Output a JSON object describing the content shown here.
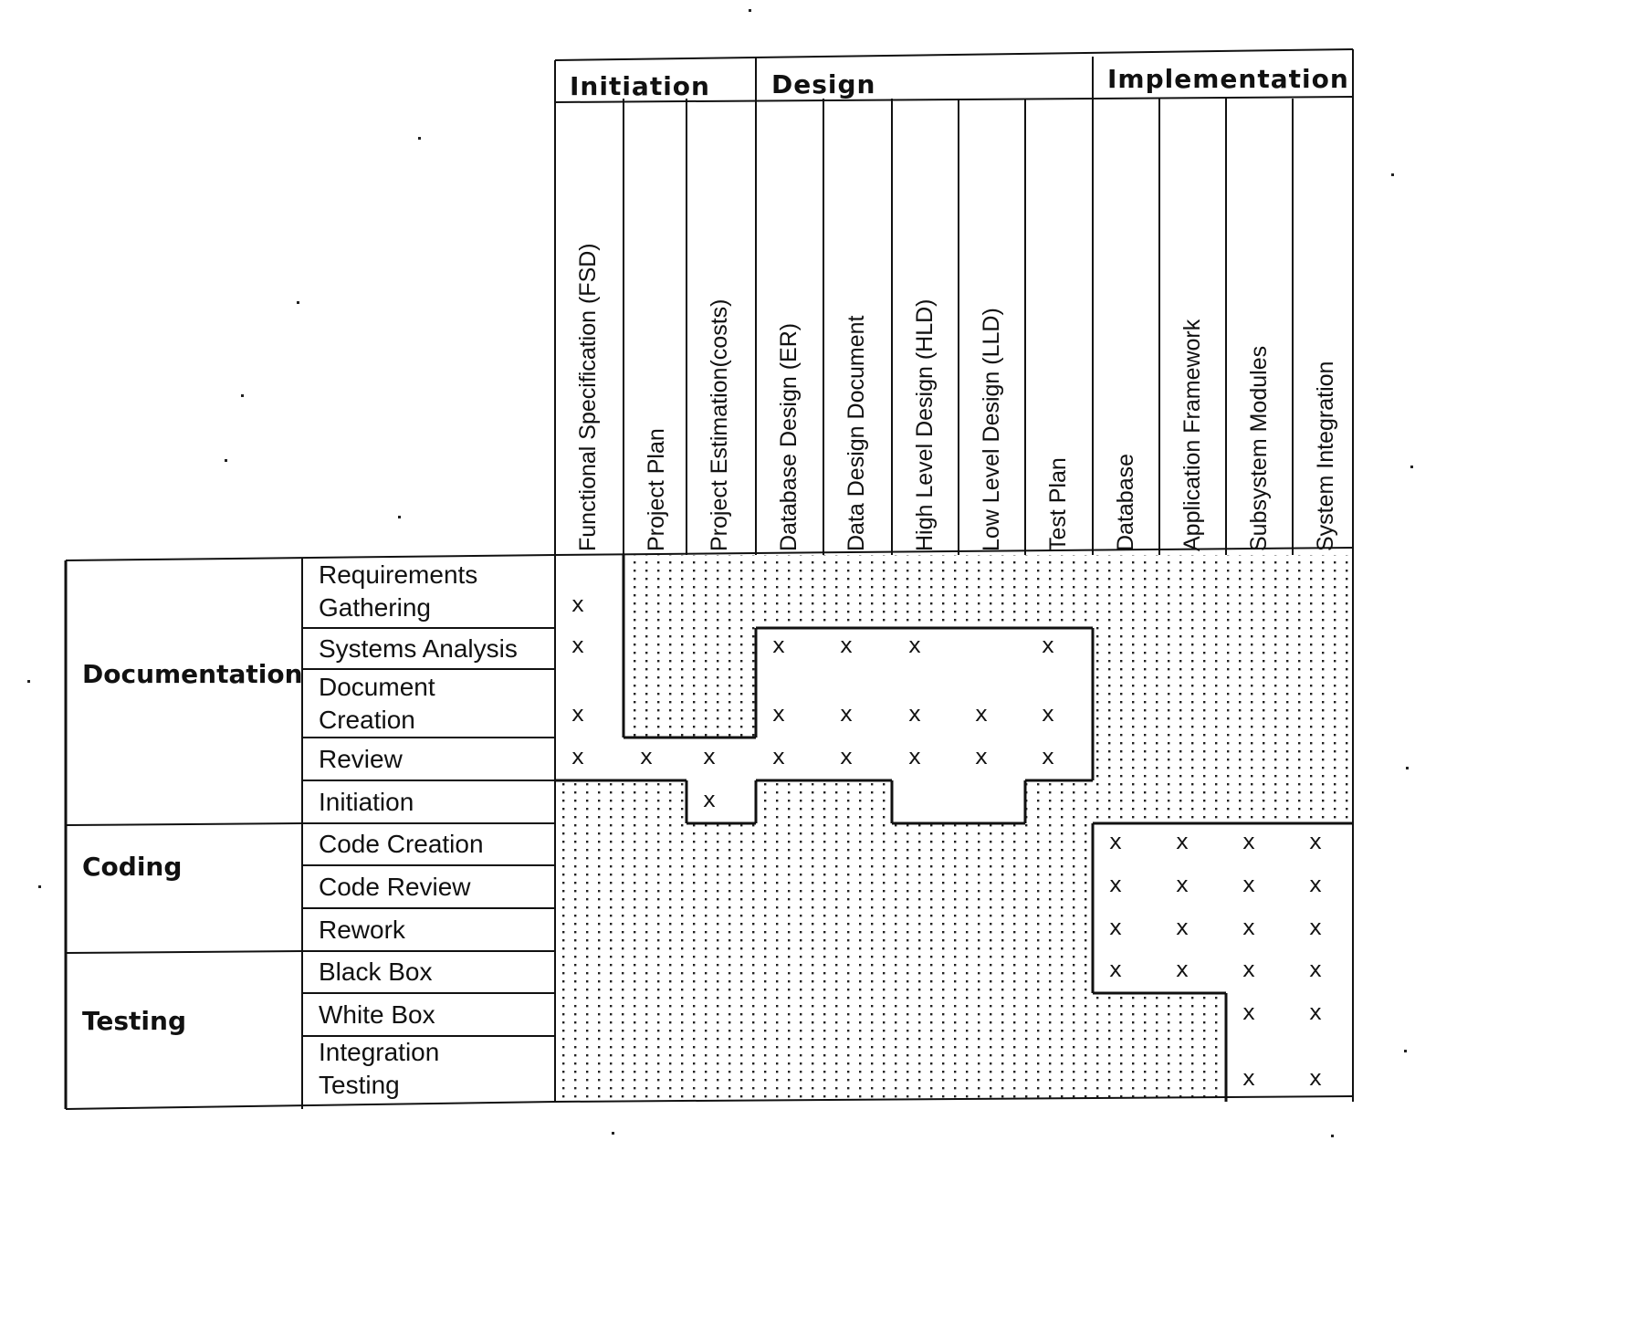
{
  "phases": [
    {
      "label": "Initiation"
    },
    {
      "label": "Design"
    },
    {
      "label": "Implementation"
    }
  ],
  "columns": [
    {
      "label": "Functional Specification (FSD)",
      "phase": "Initiation"
    },
    {
      "label": "Project Plan",
      "phase": "Initiation"
    },
    {
      "label": "Project Estimation(costs)",
      "phase": "Initiation"
    },
    {
      "label": "Database Design (ER)",
      "phase": "Design"
    },
    {
      "label": "Data Design Document",
      "phase": "Design"
    },
    {
      "label": "High Level Design (HLD)",
      "phase": "Design"
    },
    {
      "label": "Low Level Design (LLD)",
      "phase": "Design"
    },
    {
      "label": "Test Plan",
      "phase": "Design"
    },
    {
      "label": "Database",
      "phase": "Implementation"
    },
    {
      "label": "Application Framework",
      "phase": "Implementation"
    },
    {
      "label": "Subsystem Modules",
      "phase": "Implementation"
    },
    {
      "label": "System Integration",
      "phase": "Implementation"
    }
  ],
  "categories": [
    {
      "label": "Documentation"
    },
    {
      "label": "Coding"
    },
    {
      "label": "Testing"
    }
  ],
  "rows": [
    {
      "label_lines": [
        "Requirements",
        "Gathering"
      ],
      "category": "Documentation",
      "marks": [
        0
      ]
    },
    {
      "label_lines": [
        "Systems Analysis"
      ],
      "category": "Documentation",
      "marks": [
        0,
        3,
        4,
        5,
        7
      ]
    },
    {
      "label_lines": [
        "Document",
        "Creation"
      ],
      "category": "Documentation",
      "marks": [
        0,
        3,
        4,
        5,
        6,
        7
      ]
    },
    {
      "label_lines": [
        "Review"
      ],
      "category": "Documentation",
      "marks": [
        0,
        1,
        2,
        3,
        4,
        5,
        6,
        7
      ]
    },
    {
      "label_lines": [
        "Initiation"
      ],
      "category": "Documentation",
      "marks": [
        2
      ]
    },
    {
      "label_lines": [
        "Code Creation"
      ],
      "category": "Coding",
      "marks": [
        8,
        9,
        10,
        11
      ]
    },
    {
      "label_lines": [
        "Code Review"
      ],
      "category": "Coding",
      "marks": [
        8,
        9,
        10,
        11
      ]
    },
    {
      "label_lines": [
        "Rework"
      ],
      "category": "Coding",
      "marks": [
        8,
        9,
        10,
        11
      ]
    },
    {
      "label_lines": [
        "Black Box"
      ],
      "category": "Testing",
      "marks": [
        8,
        9,
        10,
        11
      ]
    },
    {
      "label_lines": [
        "White Box"
      ],
      "category": "Testing",
      "marks": [
        10,
        11
      ]
    },
    {
      "label_lines": [
        "Integration",
        "Testing"
      ],
      "category": "Testing",
      "marks": [
        10,
        11
      ]
    }
  ],
  "mark_symbol": "x",
  "colors": {
    "line": "#111111",
    "dots": "#222222",
    "background": "#ffffff"
  }
}
